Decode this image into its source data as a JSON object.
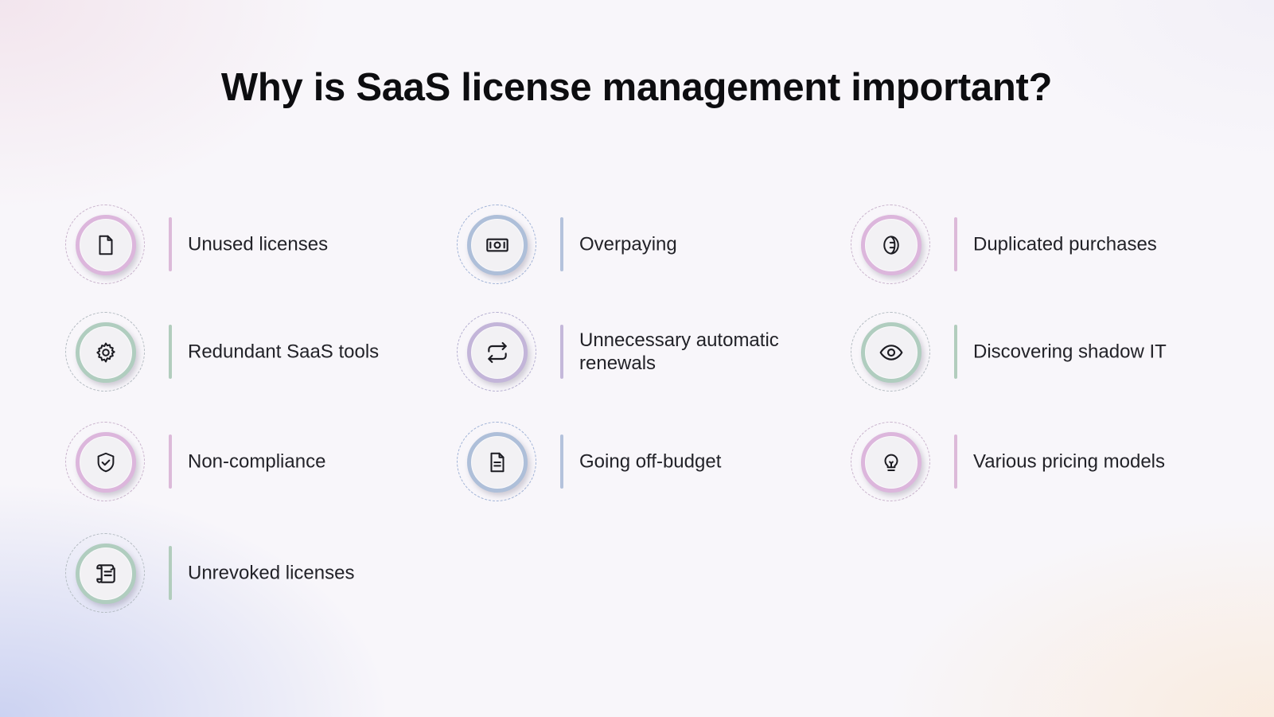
{
  "title": "Why is SaaS license management important?",
  "accent_colors": {
    "pink": "#dcb6dc",
    "blue": "#aebfd9",
    "green": "#b0cdbf",
    "lavender": "#c3b5d9"
  },
  "items": [
    {
      "label": "Unused licenses",
      "icon": "document-icon",
      "accent": "pink"
    },
    {
      "label": "Overpaying",
      "icon": "banknote-icon",
      "accent": "blue"
    },
    {
      "label": "Duplicated purchases",
      "icon": "coin-icon",
      "accent": "pink"
    },
    {
      "label": "Redundant SaaS tools",
      "icon": "gear-icon",
      "accent": "green"
    },
    {
      "label": "Unnecessary automatic renewals",
      "icon": "repeat-icon",
      "accent": "lavender"
    },
    {
      "label": "Discovering shadow IT",
      "icon": "eye-icon",
      "accent": "green"
    },
    {
      "label": "Non-compliance",
      "icon": "shield-check-icon",
      "accent": "pink"
    },
    {
      "label": "Going off-budget",
      "icon": "file-text-icon",
      "accent": "blue"
    },
    {
      "label": "Various pricing models",
      "icon": "lightbulb-icon",
      "accent": "pink"
    },
    {
      "label": "Unrevoked licenses",
      "icon": "scroll-icon",
      "accent": "green"
    }
  ]
}
